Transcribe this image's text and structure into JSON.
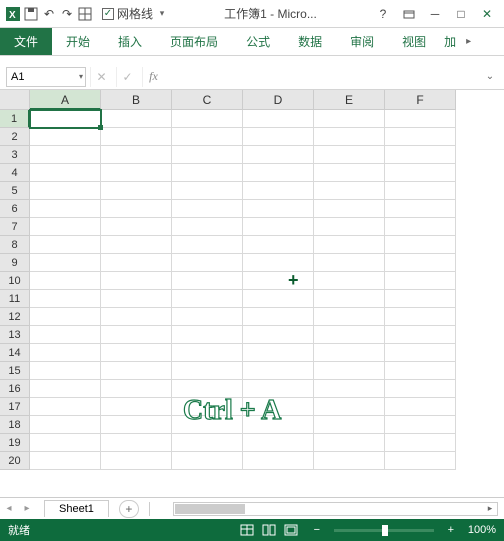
{
  "titlebar": {
    "gl_label": "网格线",
    "doc_title": "工作簿1 - Micro...",
    "gl_checked": true
  },
  "ribbon": {
    "tabs": [
      "文件",
      "开始",
      "插入",
      "页面布局",
      "公式",
      "数据",
      "审阅",
      "视图",
      "加"
    ]
  },
  "formula_bar": {
    "name_box": "A1",
    "fx": "fx",
    "value": ""
  },
  "grid": {
    "columns": [
      "A",
      "B",
      "C",
      "D",
      "E",
      "F"
    ],
    "rows": [
      1,
      2,
      3,
      4,
      5,
      6,
      7,
      8,
      9,
      10,
      11,
      12,
      13,
      14,
      15,
      16,
      17,
      18,
      19,
      20
    ],
    "active_cell": "A1"
  },
  "overlay": {
    "cursor": "+",
    "watermark": "Ctrl + A"
  },
  "sheetbar": {
    "tab": "Sheet1",
    "add": "+"
  },
  "status": {
    "ready": "就绪",
    "zoom": "100%",
    "minus": "−",
    "plus": "+"
  }
}
